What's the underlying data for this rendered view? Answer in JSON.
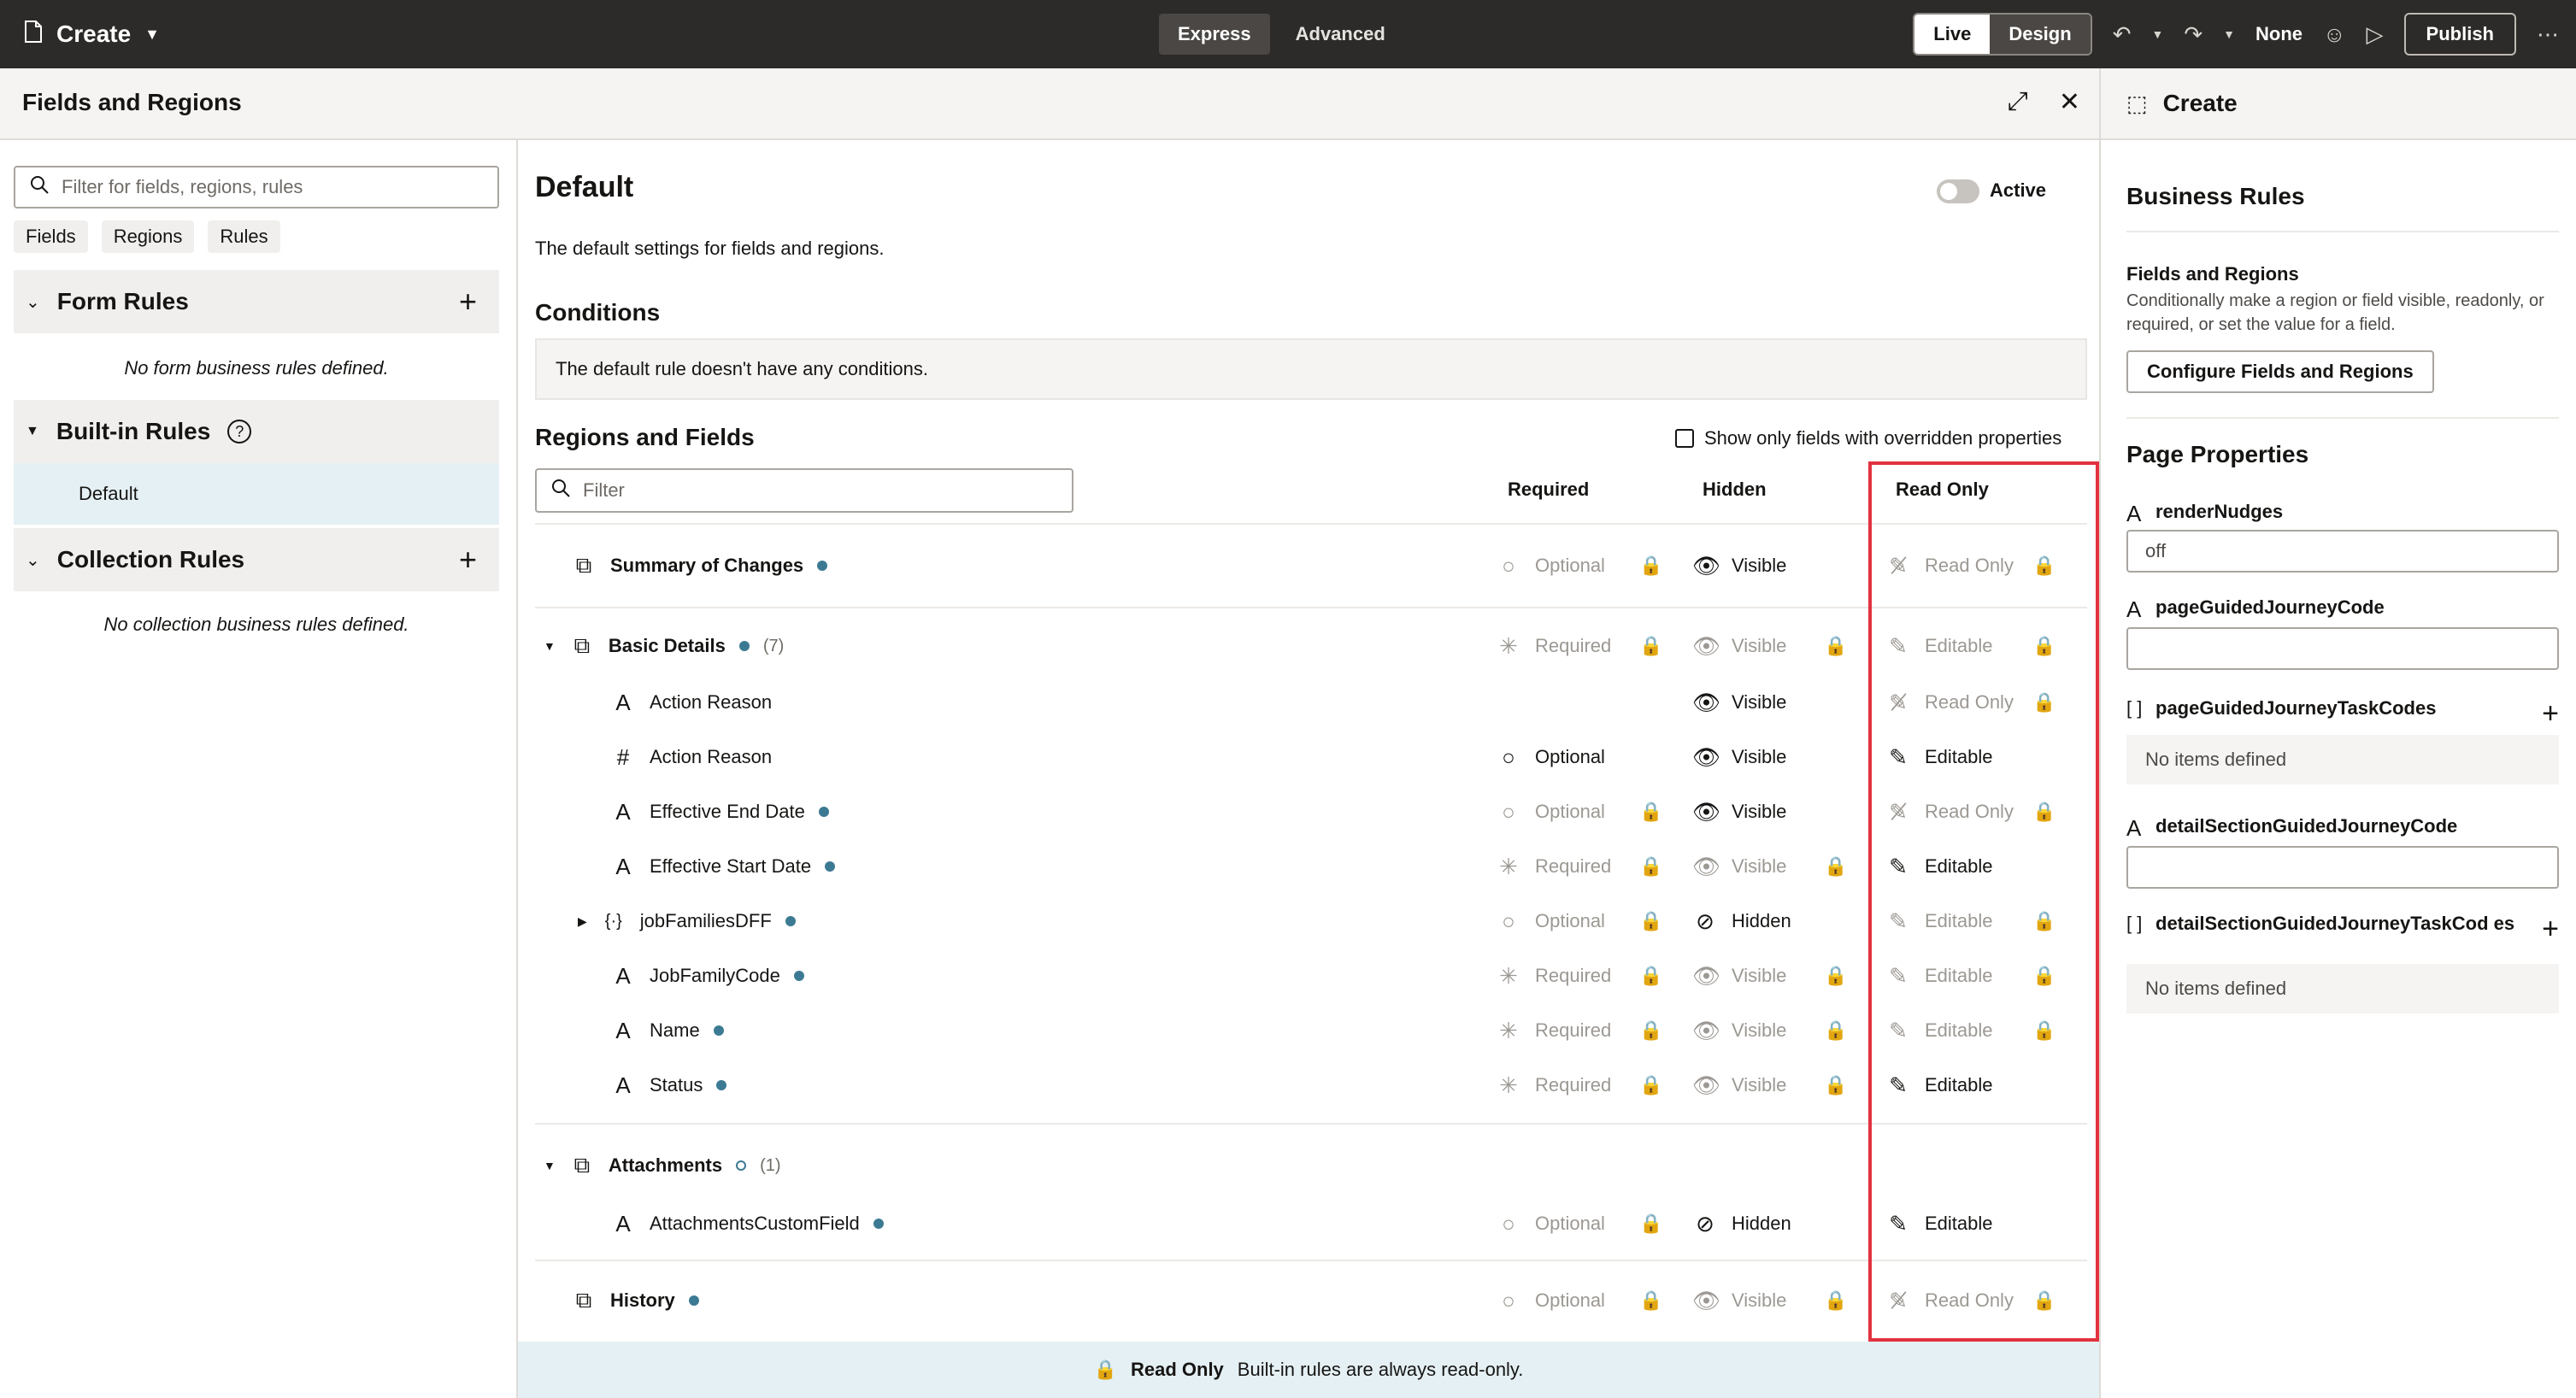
{
  "topbar": {
    "title": "Create",
    "modes": [
      "Express",
      "Advanced"
    ],
    "live": "Live",
    "design": "Design",
    "none": "None",
    "publish": "Publish"
  },
  "panel": {
    "title": "Fields and Regions",
    "search_placeholder": "Filter for fields, regions, rules",
    "chips": [
      "Fields",
      "Regions",
      "Rules"
    ],
    "form_rules": "Form Rules",
    "form_empty": "No form business rules defined.",
    "builtin_rules": "Built-in Rules",
    "default_item": "Default",
    "collection_rules": "Collection Rules",
    "collection_empty": "No collection business rules defined."
  },
  "main": {
    "title": "Default",
    "active": "Active",
    "description": "The default settings for fields and regions.",
    "conditions_title": "Conditions",
    "conditions_text": "The default rule doesn't have any conditions.",
    "regions_title": "Regions and Fields",
    "show_only": "Show only fields with overridden properties",
    "filter_placeholder": "Filter",
    "col_required": "Required",
    "col_hidden": "Hidden",
    "col_readonly": "Read Only",
    "rows": [
      {
        "name": "Summary of Changes",
        "req": "Optional",
        "hid": "Visible",
        "ro": "Read Only"
      },
      {
        "name": "Basic Details",
        "count": "(7)",
        "req": "Required",
        "hid": "Visible",
        "ro": "Editable"
      },
      {
        "name": "Action Reason",
        "req": "",
        "hid": "Visible",
        "ro": "Read Only"
      },
      {
        "name": "Action Reason",
        "req": "Optional",
        "hid": "Visible",
        "ro": "Editable"
      },
      {
        "name": "Effective End Date",
        "req": "Optional",
        "hid": "Visible",
        "ro": "Read Only"
      },
      {
        "name": "Effective Start Date",
        "req": "Required",
        "hid": "Visible",
        "ro": "Editable"
      },
      {
        "name": "jobFamiliesDFF",
        "req": "Optional",
        "hid": "Hidden",
        "ro": "Editable"
      },
      {
        "name": "JobFamilyCode",
        "req": "Required",
        "hid": "Visible",
        "ro": "Editable"
      },
      {
        "name": "Name",
        "req": "Required",
        "hid": "Visible",
        "ro": "Editable"
      },
      {
        "name": "Status",
        "req": "Required",
        "hid": "Visible",
        "ro": "Editable"
      },
      {
        "name": "Attachments",
        "count": "(1)",
        "req": "",
        "hid": "",
        "ro": ""
      },
      {
        "name": "AttachmentsCustomField",
        "req": "Optional",
        "hid": "Hidden",
        "ro": "Editable"
      },
      {
        "name": "History",
        "req": "Optional",
        "hid": "Visible",
        "ro": "Read Only"
      }
    ],
    "footer_bold": "Read Only",
    "footer_text": "Built-in rules are always read-only."
  },
  "right": {
    "title": "Create",
    "business_rules": "Business Rules",
    "fr_title": "Fields and Regions",
    "fr_desc": "Conditionally make a region or field visible, readonly, or required, or set the value for a field.",
    "configure": "Configure Fields and Regions",
    "page_props": "Page Properties",
    "p1": "renderNudges",
    "p1_value": "off",
    "p2": "pageGuidedJourneyCode",
    "p3": "pageGuidedJourneyTaskCodes",
    "none1": "No items defined",
    "p4": "detailSectionGuidedJourneyCode",
    "p5": "detailSectionGuidedJourneyTaskCod es",
    "none2": "No items defined"
  }
}
